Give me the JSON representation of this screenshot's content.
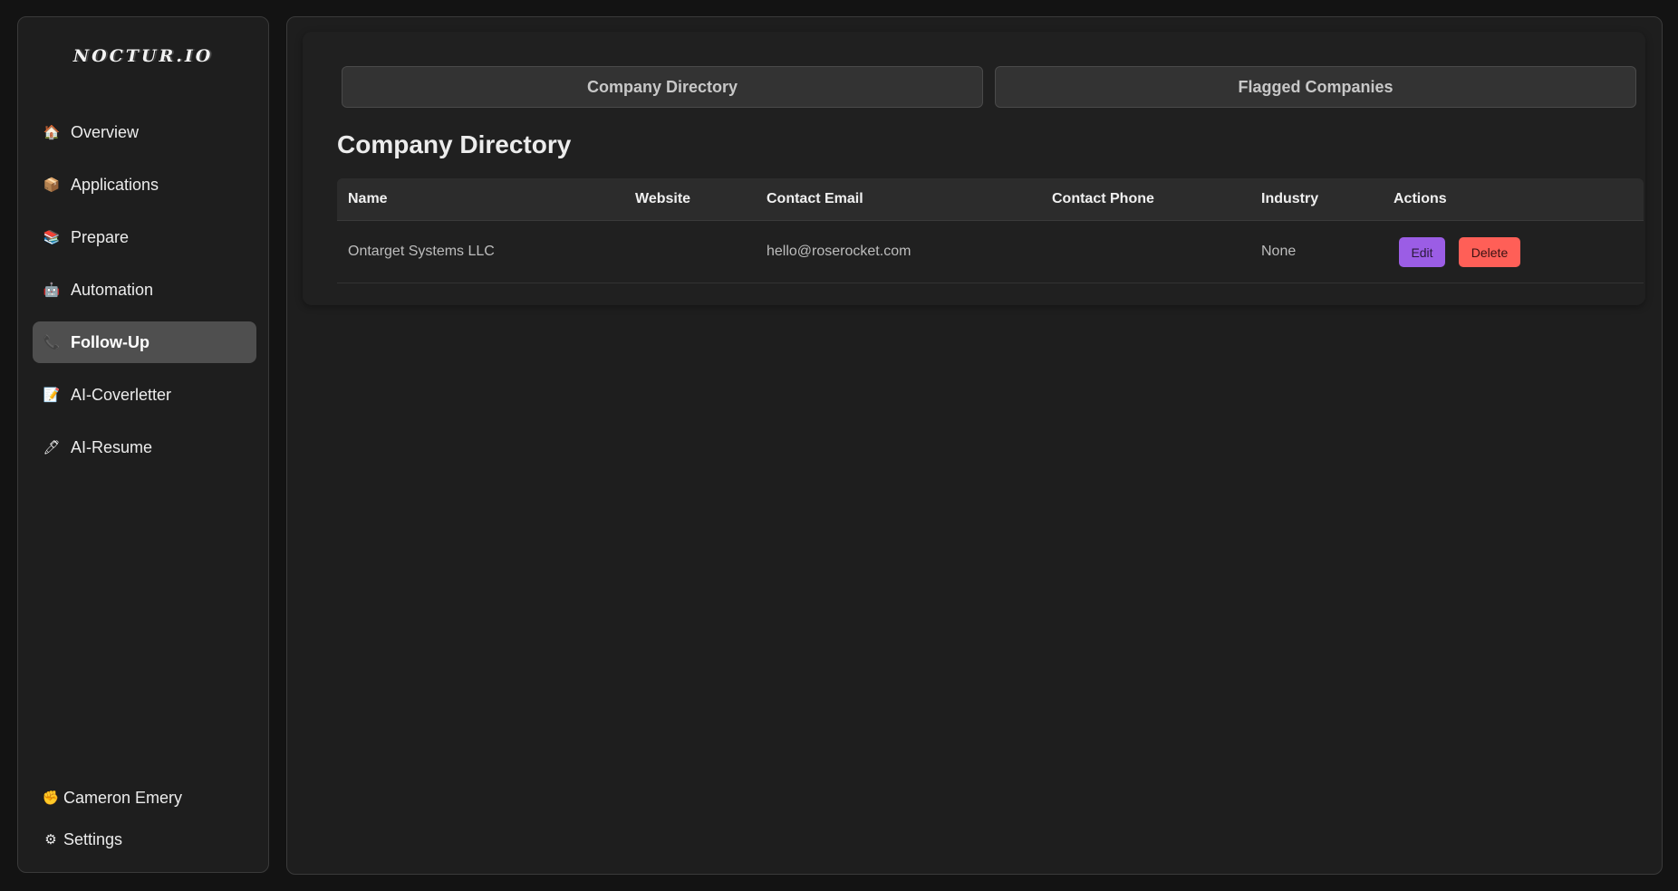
{
  "app": {
    "logo": "NOCTUR.IO"
  },
  "sidebar": {
    "items": [
      {
        "label": "Overview",
        "icon": "🏠"
      },
      {
        "label": "Applications",
        "icon": "📦"
      },
      {
        "label": "Prepare",
        "icon": "📚"
      },
      {
        "label": "Automation",
        "icon": "🤖"
      },
      {
        "label": "Follow-Up",
        "icon": "📞",
        "active": true
      },
      {
        "label": "AI-Coverletter",
        "icon": "📝"
      },
      {
        "label": "AI-Resume",
        "icon": "🖊"
      }
    ],
    "user": {
      "label": "Cameron Emery",
      "icon": "✊"
    },
    "settings": {
      "label": "Settings",
      "icon": "⚙"
    }
  },
  "tabs": [
    {
      "label": "Company Directory"
    },
    {
      "label": "Flagged Companies"
    }
  ],
  "section": {
    "title": "Company Directory"
  },
  "table": {
    "columns": [
      "Name",
      "Website",
      "Contact Email",
      "Contact Phone",
      "Industry",
      "Actions"
    ],
    "rows": [
      {
        "name": "Ontarget Systems LLC",
        "website": "",
        "email": "hello@roserocket.com",
        "phone": "",
        "industry": "None",
        "edit_label": "Edit",
        "delete_label": "Delete"
      }
    ]
  },
  "colors": {
    "edit": "#9b5de5",
    "delete": "#ff5f57",
    "active_nav": "#4f4f4f"
  }
}
